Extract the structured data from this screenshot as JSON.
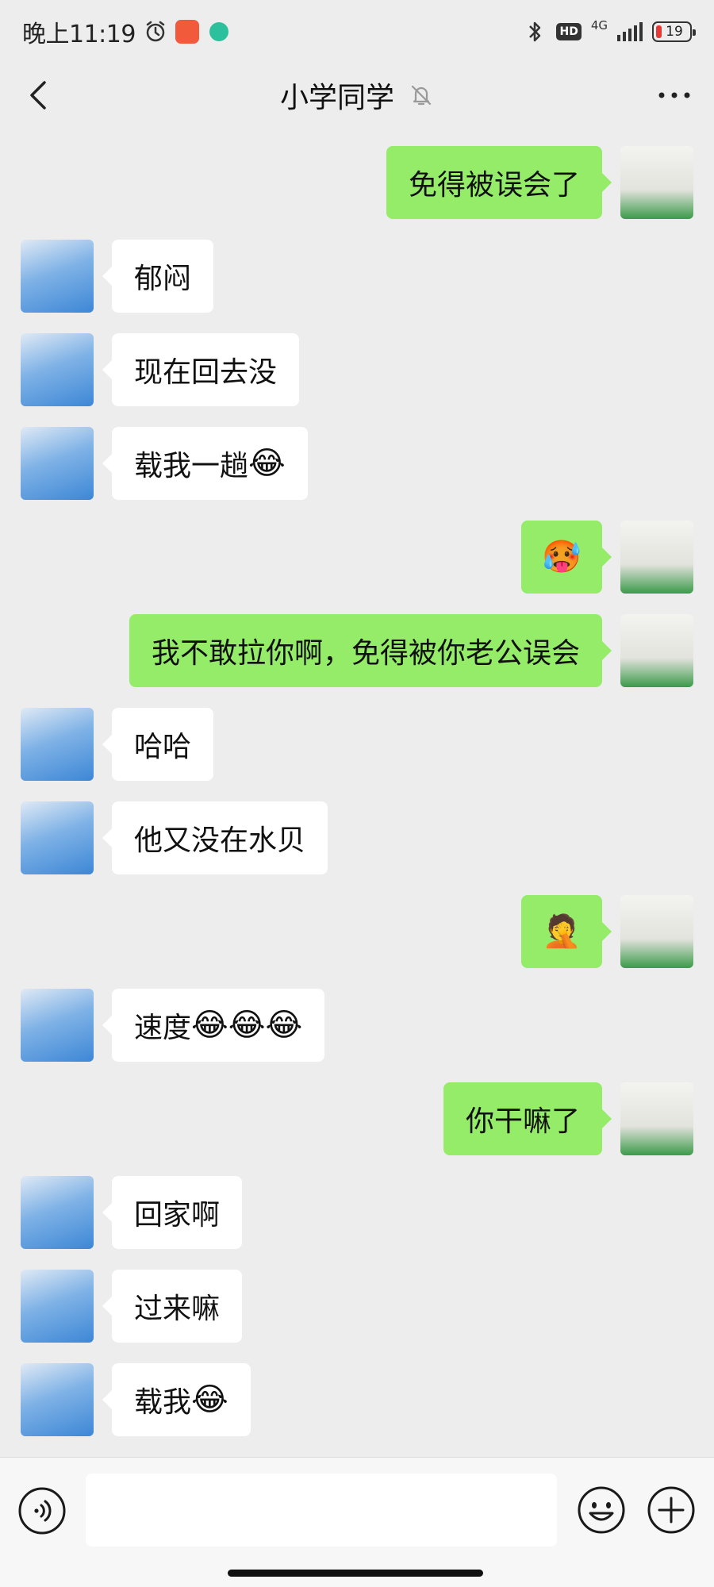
{
  "status_bar": {
    "time": "晚上11:19",
    "network": "4G",
    "hd": "HD",
    "battery": "19"
  },
  "nav": {
    "title": "小学同学"
  },
  "messages": [
    {
      "sender": "me",
      "text": "免得被误会了"
    },
    {
      "sender": "her",
      "text": "郁闷"
    },
    {
      "sender": "her",
      "text": "现在回去没"
    },
    {
      "sender": "her",
      "text": "载我一趟",
      "emoji": "😂"
    },
    {
      "sender": "me",
      "text": "",
      "emoji": "🥵"
    },
    {
      "sender": "me",
      "text": "我不敢拉你啊，免得被你老公误会"
    },
    {
      "sender": "her",
      "text": "哈哈"
    },
    {
      "sender": "her",
      "text": "他又没在水贝"
    },
    {
      "sender": "me",
      "text": "",
      "emoji": "🤦"
    },
    {
      "sender": "her",
      "text": "速度",
      "emoji": "😂😂😂"
    },
    {
      "sender": "me",
      "text": "你干嘛了"
    },
    {
      "sender": "her",
      "text": "回家啊"
    },
    {
      "sender": "her",
      "text": "过来嘛"
    },
    {
      "sender": "her",
      "text": "载我",
      "emoji": "😂"
    }
  ],
  "input": {
    "value": "",
    "placeholder": ""
  },
  "icons": {
    "back": "chevron-left-icon",
    "mute": "bell-off-icon",
    "more": "more-dots-icon",
    "voice": "voice-icon",
    "emoji": "smiley-icon",
    "plus": "plus-circle-icon"
  },
  "colors": {
    "background": "#ededed",
    "sent_bubble": "#95ec69",
    "received_bubble": "#ffffff",
    "input_bar": "#f7f7f7"
  }
}
